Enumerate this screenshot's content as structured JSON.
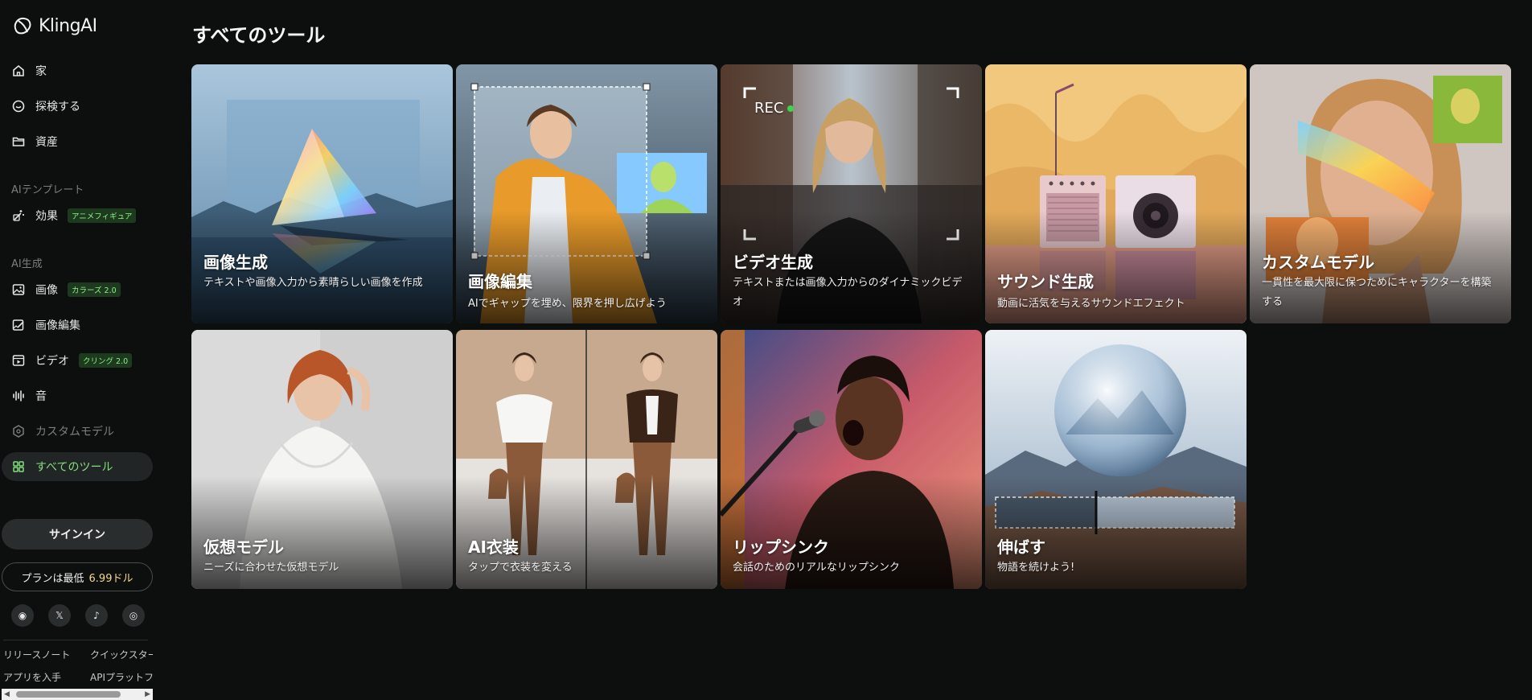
{
  "app": {
    "logo_text": "KlingAI"
  },
  "sidebar": {
    "items": [
      {
        "label": "家",
        "icon": "home-icon"
      },
      {
        "label": "探検する",
        "icon": "explore-icon"
      },
      {
        "label": "資産",
        "icon": "folder-icon"
      }
    ],
    "section_templates": "AIテンプレート",
    "template_items": [
      {
        "label": "効果",
        "badge": "アニメフィギュア",
        "icon": "effects-icon"
      }
    ],
    "section_generate": "AI生成",
    "generate_items": [
      {
        "label": "画像",
        "badge": "カラーズ 2.0",
        "icon": "image-icon"
      },
      {
        "label": "画像編集",
        "icon": "image-edit-icon"
      },
      {
        "label": "ビデオ",
        "badge": "クリング 2.0",
        "icon": "video-icon"
      },
      {
        "label": "音",
        "icon": "sound-icon"
      },
      {
        "label": "カスタムモデル",
        "icon": "custom-model-icon"
      },
      {
        "label": "すべてのツール",
        "icon": "grid-icon"
      }
    ],
    "signin_label": "サインイン",
    "plan_label": "プランは最低",
    "plan_price": "6.99ドル",
    "social": [
      {
        "name": "discord-icon",
        "glyph": "◉"
      },
      {
        "name": "x-icon",
        "glyph": "𝕏"
      },
      {
        "name": "tiktok-icon",
        "glyph": "♪"
      },
      {
        "name": "instagram-icon",
        "glyph": "◎"
      }
    ],
    "footer_links": [
      "リリースノート",
      "クイックスター",
      "アプリを入手",
      "APIプラットフ"
    ]
  },
  "main": {
    "title": "すべてのツール",
    "tools": [
      {
        "title": "画像生成",
        "desc": "テキストや画像入力から素晴らしい画像を作成"
      },
      {
        "title": "画像編集",
        "desc": "AIでギャップを埋め、限界を押し広げよう"
      },
      {
        "title": "ビデオ生成",
        "desc": "テキストまたは画像入力からのダイナミックビデオ",
        "overlay": "REC"
      },
      {
        "title": "サウンド生成",
        "desc": "動画に活気を与えるサウンドエフェクト"
      },
      {
        "title": "カスタムモデル",
        "desc": "一貫性を最大限に保つためにキャラクターを構築する"
      },
      {
        "title": "仮想モデル",
        "desc": "ニーズに合わせた仮想モデル"
      },
      {
        "title": "AI衣装",
        "desc": "タップで衣装を変える"
      },
      {
        "title": "リップシンク",
        "desc": "会話のためのリアルなリップシンク"
      },
      {
        "title": "伸ばす",
        "desc": "物語を続けよう!"
      }
    ]
  },
  "colors": {
    "accent": "#7fe07a",
    "background": "#0d0e0e",
    "badge_bg": "#1d3a1f",
    "price": "#f4d78a"
  }
}
